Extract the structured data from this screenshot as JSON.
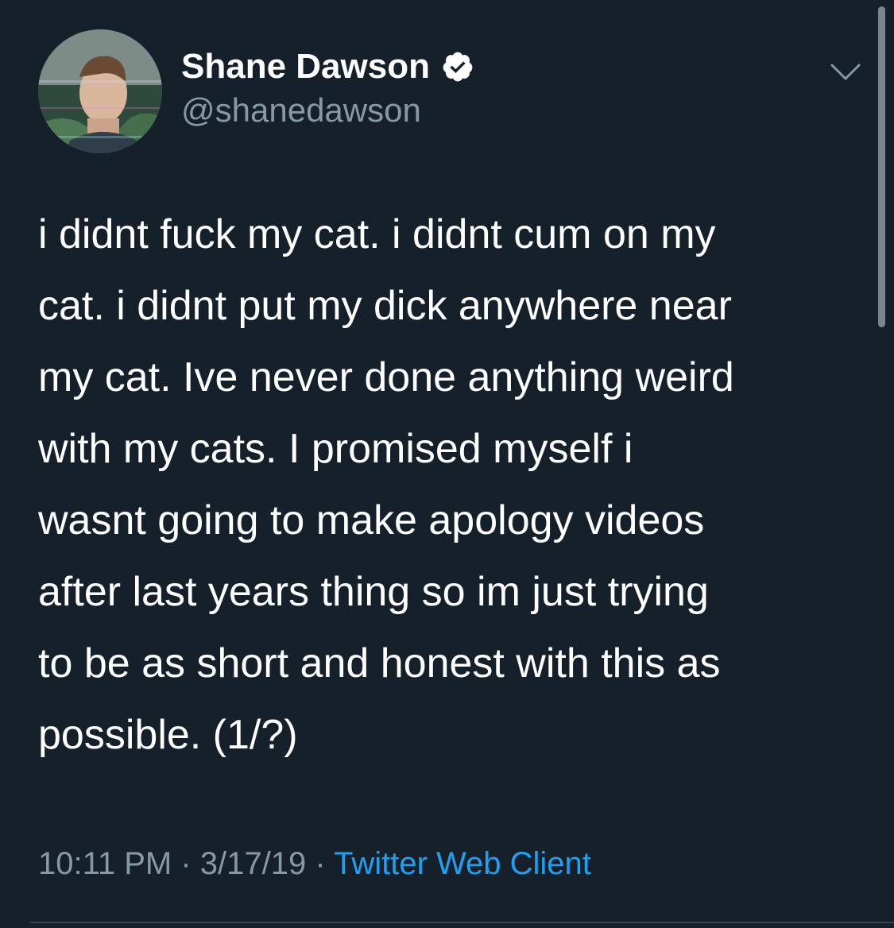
{
  "user": {
    "display_name": "Shane Dawson",
    "handle": "@shanedawson",
    "verified": true
  },
  "tweet": {
    "lines": [
      "i didnt fuck my cat. i didnt cum on my",
      "cat. i didnt put my dick anywhere near",
      "my cat. Ive never done anything weird",
      "with my cats. I promised myself i",
      "wasnt going to make apology videos",
      "after last years thing so im just trying",
      "to be as short and honest with this as",
      "possible. (1/?)"
    ]
  },
  "meta": {
    "time": "10:11 PM",
    "separator": " · ",
    "date": "3/17/19",
    "source": "Twitter Web Client"
  },
  "icons": {
    "verified": "verified-badge-icon",
    "menu": "chevron-down-icon"
  },
  "colors": {
    "background": "#15202b",
    "text": "#ffffff",
    "secondary_text": "#8899a6",
    "link": "#1da1f2"
  }
}
